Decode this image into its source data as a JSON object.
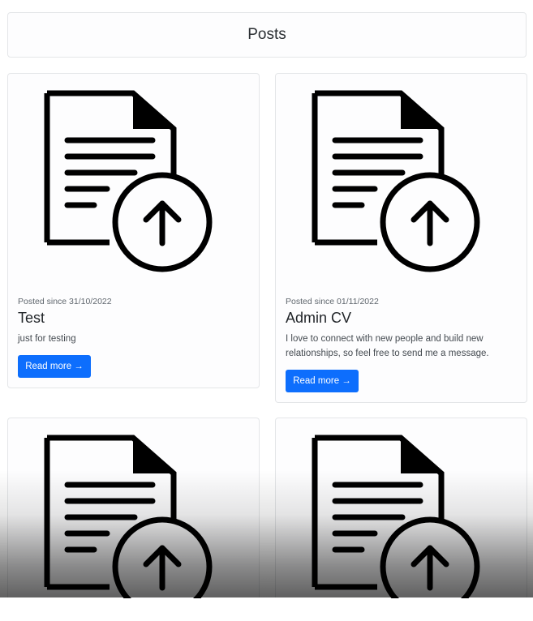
{
  "header": {
    "title": "Posts"
  },
  "posts": [
    {
      "meta": "Posted since 31/10/2022",
      "title": "Test",
      "text": "just for testing",
      "button": "Read more →",
      "icon": "file-upload-icon"
    },
    {
      "meta": "Posted since 01/11/2022",
      "title": "Admin CV",
      "text": "I love to connect with new people and build new relationships, so feel free to send me a message.",
      "button": "Read more →",
      "icon": "file-upload-icon"
    },
    {
      "icon": "file-upload-icon"
    },
    {
      "icon": "file-upload-icon"
    }
  ],
  "colors": {
    "primary": "#0d6efd",
    "border": "#e4e6e8"
  }
}
